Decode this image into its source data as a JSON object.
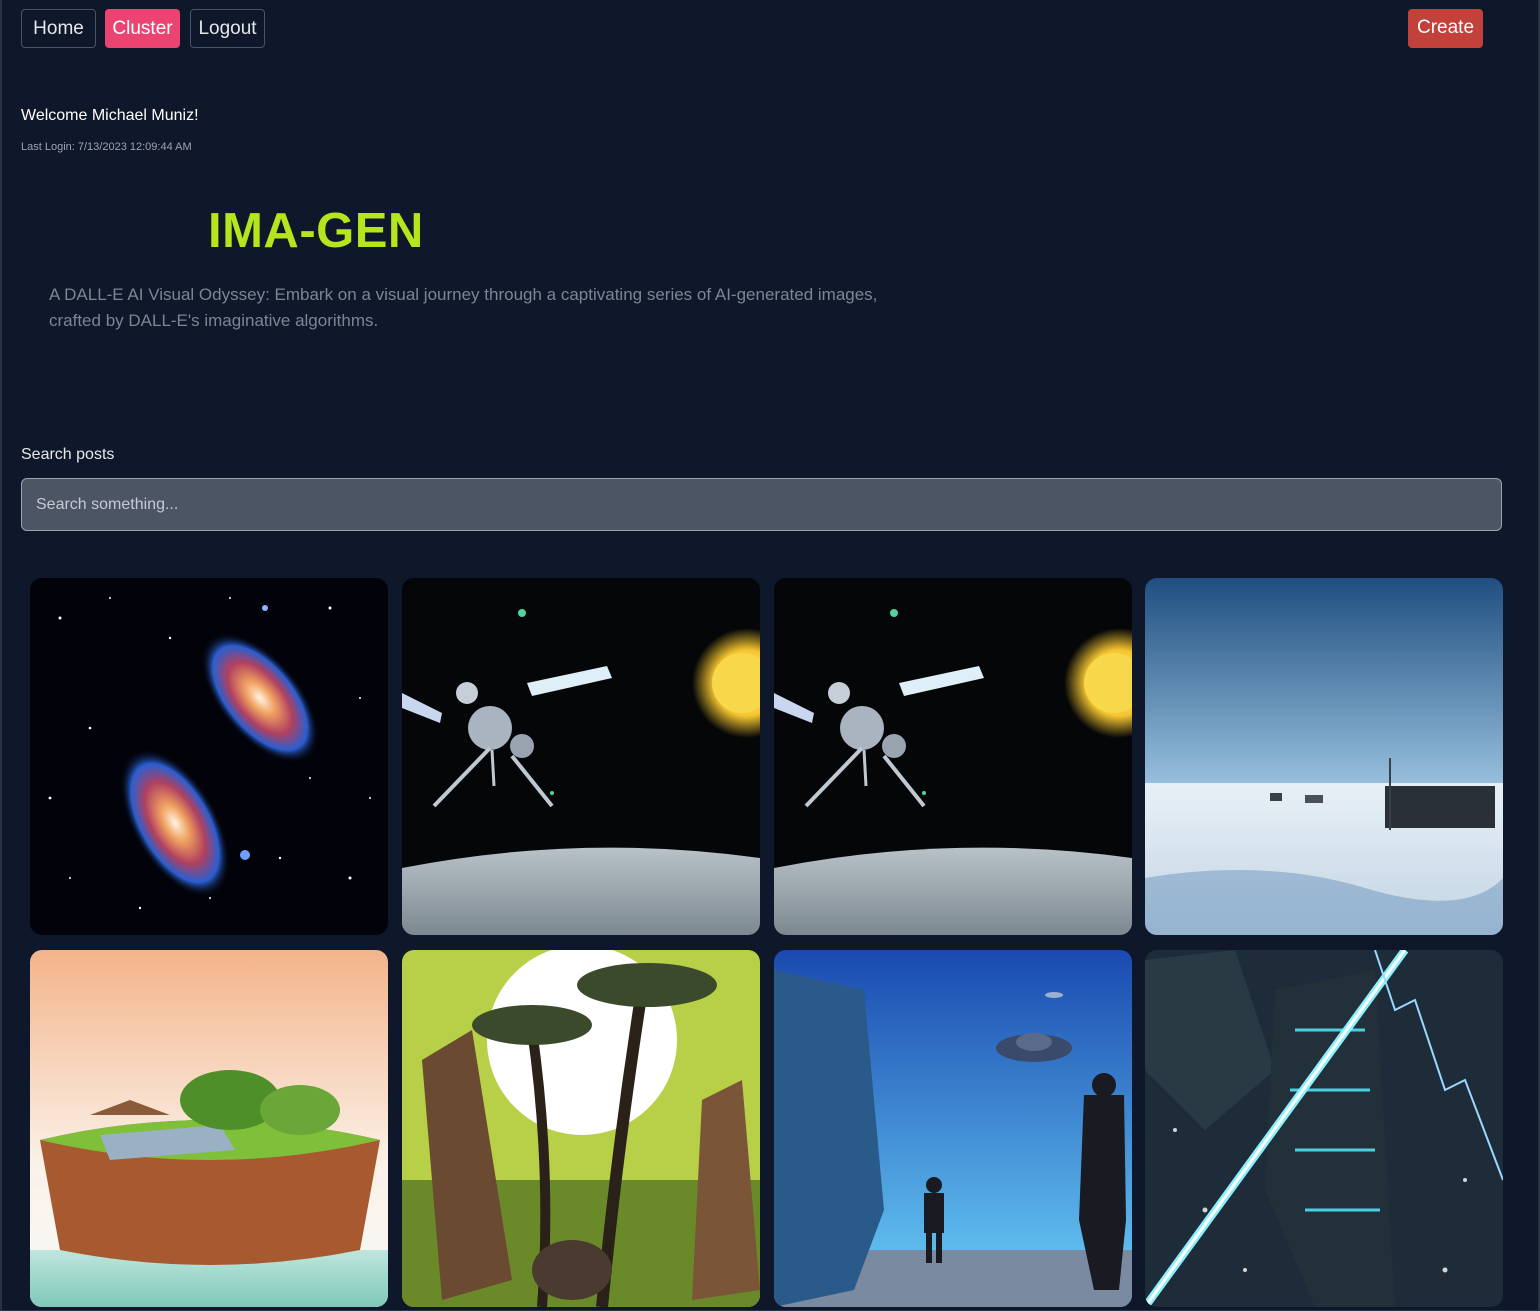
{
  "nav": {
    "home_label": "Home",
    "cluster_label": "Cluster",
    "logout_label": "Logout",
    "create_label": "Create",
    "active_tab": "Cluster"
  },
  "user": {
    "welcome": "Welcome Michael Muniz!",
    "last_login": "Last Login: 7/13/2023 12:09:44 AM"
  },
  "hero": {
    "brand": "IMA-GEN",
    "tagline": "A DALL-E AI Visual Odyssey: Embark on a visual journey through a captivating series of AI-generated images, crafted by DALL-E's imaginative algorithms."
  },
  "search": {
    "label": "Search posts",
    "placeholder": "Search something...",
    "value": ""
  },
  "gallery": {
    "images": [
      {
        "subject": "two spiral galaxies in space"
      },
      {
        "subject": "satellite over lunar surface with sun"
      },
      {
        "subject": "satellite over lunar surface with sun"
      },
      {
        "subject": "snowy arctic plain with research station"
      },
      {
        "subject": "floating island with solar panels and trees"
      },
      {
        "subject": "jungle palms with ancient stone heads and moon"
      },
      {
        "subject": "alien ruins with UFO and silhouetted figures"
      },
      {
        "subject": "dark crystalline tower struck by blue lightning"
      }
    ]
  },
  "colors": {
    "background": "#0f172a",
    "brand": "#b5e51d",
    "cluster_active": "#ec4472",
    "create": "#c2413b",
    "search_bg": "#4b5563"
  }
}
